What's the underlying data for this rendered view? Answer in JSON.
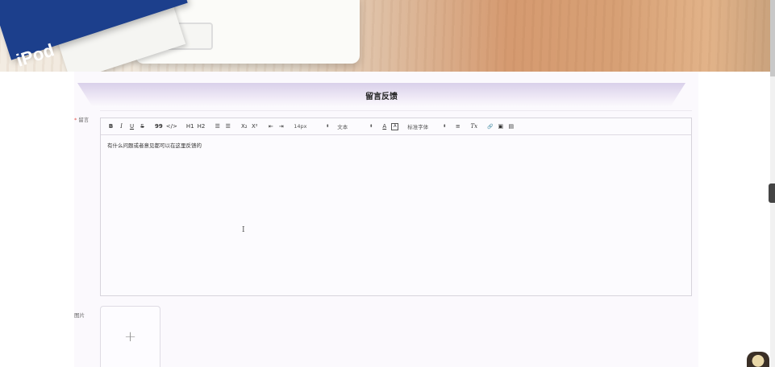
{
  "page": {
    "section_title": "留言反馈",
    "message_label": "留言",
    "required_mark": "*",
    "image_label": "图片",
    "cursor_glyph": "I"
  },
  "hero": {
    "poster_text": "iPod"
  },
  "editor": {
    "content": "有什么问题或者意见都可以在这里反馈的",
    "toolbar": {
      "bold": "B",
      "italic": "I",
      "underline": "U",
      "strike": "S",
      "blockquote": "99",
      "code_block": "</>",
      "header1": "H1",
      "header2": "H2",
      "ordered_list": "☰",
      "bullet_list": "☰",
      "subscript": "X₂",
      "superscript": "X²",
      "indent_out": "⇤",
      "indent_in": "⇥",
      "font_size": "14px",
      "block_format": "文本",
      "text_color": "A",
      "background_color": "A",
      "font_family": "标准字体",
      "align": "≡",
      "clear_format": "Tx",
      "link": "🔗",
      "image": "▣",
      "video": "▤",
      "picker_arrow": "⬍"
    }
  },
  "upload": {
    "plus": "+"
  },
  "colors": {
    "title_gradient_top": "#d9d0ea",
    "panel_bg": "#fbf9fd",
    "required": "#e2534b"
  }
}
